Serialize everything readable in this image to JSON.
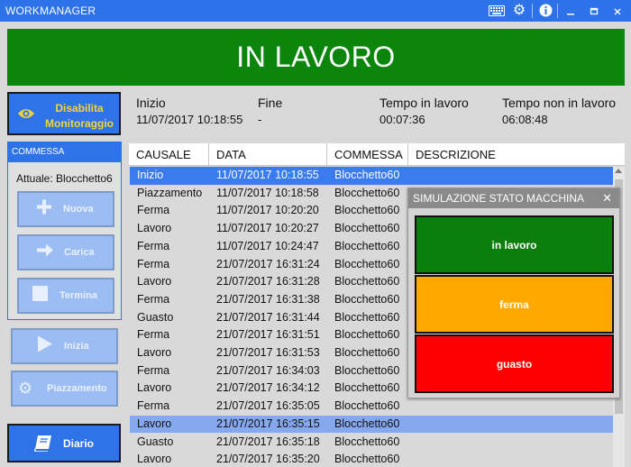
{
  "window": {
    "title": "WORKMANAGER",
    "icons": [
      "keyboard-icon",
      "gear-icon",
      "info-icon",
      "minimize-icon",
      "maximize-icon",
      "close-icon"
    ]
  },
  "status": {
    "text": "IN LAVORO",
    "color": "#0b850b"
  },
  "sidebar": {
    "monitor_button_label": "Disabilita Monitoraggio",
    "commessa_header": "COMMESSA",
    "attuale": "Attuale: Blocchetto6",
    "nuova": "Nuova",
    "carica": "Carica",
    "termina": "Termina",
    "inizia": "Inizia",
    "piazzamento": "Piazzamento",
    "diario": "Diario"
  },
  "info": {
    "inizio_label": "Inizio",
    "inizio_value": "11/07/2017 10:18:55",
    "fine_label": "Fine",
    "fine_value": "-",
    "tempo_lavoro_label": "Tempo in lavoro",
    "tempo_lavoro_value": "00:07:36",
    "tempo_non_lavoro_label": "Tempo non in lavoro",
    "tempo_non_lavoro_value": "06:08:48"
  },
  "table": {
    "columns": [
      "CAUSALE",
      "DATA",
      "COMMESSA",
      "DESCRIZIONE"
    ],
    "rows": [
      {
        "causale": "Inizio",
        "data": "11/07/2017 10:18:55",
        "commessa": "Blocchetto60",
        "selected": "dark"
      },
      {
        "causale": "Piazzamento",
        "data": "11/07/2017 10:18:58",
        "commessa": "Blocchetto60"
      },
      {
        "causale": "Ferma",
        "data": "11/07/2017 10:20:20",
        "commessa": "Blocchetto60"
      },
      {
        "causale": "Lavoro",
        "data": "11/07/2017 10:20:27",
        "commessa": "Blocchetto60"
      },
      {
        "causale": "Ferma",
        "data": "11/07/2017 10:24:47",
        "commessa": "Blocchetto60"
      },
      {
        "causale": "Ferma",
        "data": "21/07/2017 16:31:24",
        "commessa": "Blocchetto60"
      },
      {
        "causale": "Lavoro",
        "data": "21/07/2017 16:31:28",
        "commessa": "Blocchetto60"
      },
      {
        "causale": "Ferma",
        "data": "21/07/2017 16:31:38",
        "commessa": "Blocchetto60"
      },
      {
        "causale": "Guasto",
        "data": "21/07/2017 16:31:44",
        "commessa": "Blocchetto60"
      },
      {
        "causale": "Ferma",
        "data": "21/07/2017 16:31:51",
        "commessa": "Blocchetto60"
      },
      {
        "causale": "Lavoro",
        "data": "21/07/2017 16:31:53",
        "commessa": "Blocchetto60"
      },
      {
        "causale": "Ferma",
        "data": "21/07/2017 16:34:03",
        "commessa": "Blocchetto60"
      },
      {
        "causale": "Lavoro",
        "data": "21/07/2017 16:34:12",
        "commessa": "Blocchetto60"
      },
      {
        "causale": "Ferma",
        "data": "21/07/2017 16:35:05",
        "commessa": "Blocchetto60"
      },
      {
        "causale": "Lavoro",
        "data": "21/07/2017 16:35:15",
        "commessa": "Blocchetto60",
        "selected": "light"
      },
      {
        "causale": "Guasto",
        "data": "21/07/2017 16:35:18",
        "commessa": "Blocchetto60"
      },
      {
        "causale": "Lavoro",
        "data": "21/07/2017 16:35:20",
        "commessa": "Blocchetto60"
      }
    ]
  },
  "simulation": {
    "title": "SIMULAZIONE STATO MACCHINA",
    "buttons": [
      {
        "label": "in lavoro",
        "color": "#0b7e0b"
      },
      {
        "label": "ferma",
        "color": "#fea800"
      },
      {
        "label": "guasto",
        "color": "#fe0000"
      }
    ]
  }
}
